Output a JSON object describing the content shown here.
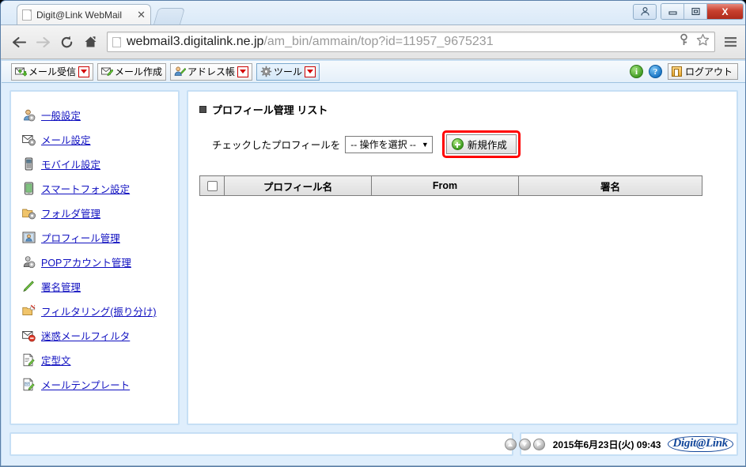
{
  "window": {
    "title": "Digit@Link WebMail",
    "buttons": {
      "user": "user-account",
      "minimize": "—",
      "maximize": "❐",
      "close": "X"
    }
  },
  "browser": {
    "tab": {
      "title": "Digit@Link WebMail",
      "close": "✕"
    },
    "nav": {
      "back": "back-arrow",
      "forward": "forward-arrow",
      "reload": "reload",
      "home": "home"
    },
    "url": {
      "domain": "webmail3.digitalink.ne.jp",
      "path": "/am_bin/ammain/top?id=11957_9675231"
    },
    "actions": {
      "key": "key-icon",
      "bookmark": "star-icon",
      "menu": "hamburger-menu"
    }
  },
  "webmail_toolbar": {
    "items": [
      {
        "label": "メール受信",
        "icon": "mail-receive-icon",
        "has_arrow": true,
        "active": false
      },
      {
        "label": "メール作成",
        "icon": "mail-compose-icon",
        "has_arrow": false,
        "active": false
      },
      {
        "label": "アドレス帳",
        "icon": "address-book-icon",
        "has_arrow": true,
        "active": false
      },
      {
        "label": "ツール",
        "icon": "tools-gear-icon",
        "has_arrow": true,
        "active": true
      }
    ],
    "info_label": "i",
    "help_label": "?",
    "logout_label": "ログアウト"
  },
  "sidebar": {
    "items": [
      {
        "label": "一般設定",
        "icon": "general-settings-icon"
      },
      {
        "label": "メール設定",
        "icon": "mail-settings-icon"
      },
      {
        "label": "モバイル設定",
        "icon": "mobile-settings-icon"
      },
      {
        "label": "スマートフォン設定",
        "icon": "smartphone-settings-icon"
      },
      {
        "label": "フォルダ管理",
        "icon": "folder-manage-icon"
      },
      {
        "label": "プロフィール管理",
        "icon": "profile-manage-icon"
      },
      {
        "label": "POPアカウント管理",
        "icon": "pop-account-icon"
      },
      {
        "label": "署名管理",
        "icon": "signature-icon"
      },
      {
        "label": "フィルタリング(振り分け)",
        "icon": "filtering-icon"
      },
      {
        "label": "迷惑メールフィルタ",
        "icon": "spam-filter-icon"
      },
      {
        "label": "定型文",
        "icon": "fixed-phrase-icon"
      },
      {
        "label": "メールテンプレート",
        "icon": "mail-template-icon"
      }
    ]
  },
  "content": {
    "title": "プロフィール管理  リスト",
    "action_label": "チェックしたプロフィールを",
    "select_value": "-- 操作を選択 --",
    "select_caret": "▼",
    "new_button_label": "新規作成",
    "table": {
      "headers": [
        "",
        "プロフィール名",
        "From",
        "署名"
      ],
      "rows": []
    }
  },
  "status": {
    "nav_up": "scroll-up",
    "nav_down": "scroll-down",
    "nav_next": "go-next",
    "datetime": "2015年6月23日(火) 09:43",
    "brand": "Digit@Link"
  },
  "colors": {
    "accent_blue": "#c6dff5",
    "link_blue": "#1010c0",
    "highlight_red": "#ff0000",
    "brand_blue": "#14489b",
    "close_red": "#c8402f"
  }
}
